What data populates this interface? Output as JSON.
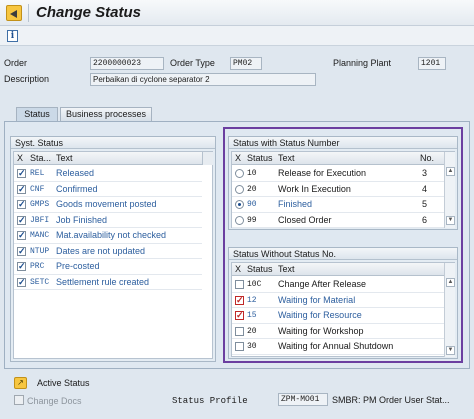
{
  "title": "Change Status",
  "header": {
    "order_label": "Order",
    "order_value": "2200000023",
    "order_type_label": "Order Type",
    "order_type_value": "PM02",
    "planning_plant_label": "Planning Plant",
    "planning_plant_value": "1201",
    "description_label": "Description",
    "description_value": "Perbaikan di cyclone separator 2"
  },
  "tabs": [
    {
      "label": "Status",
      "active": true
    },
    {
      "label": "Business processes",
      "active": false
    }
  ],
  "syst_status": {
    "title": "Syst. Status",
    "columns": [
      "X",
      "Sta...",
      "Text"
    ],
    "rows": [
      {
        "checked": true,
        "code": "REL",
        "text": "Released"
      },
      {
        "checked": true,
        "code": "CNF",
        "text": "Confirmed"
      },
      {
        "checked": true,
        "code": "GMPS",
        "text": "Goods movement posted"
      },
      {
        "checked": true,
        "code": "JBFI",
        "text": "Job Finished"
      },
      {
        "checked": true,
        "code": "MANC",
        "text": "Mat.availability not checked"
      },
      {
        "checked": true,
        "code": "NTUP",
        "text": "Dates are not updated"
      },
      {
        "checked": true,
        "code": "PRC",
        "text": "Pre-costed"
      },
      {
        "checked": true,
        "code": "SETC",
        "text": "Settlement rule created"
      }
    ]
  },
  "status_with_number": {
    "title": "Status with Status Number",
    "columns": [
      "X",
      "Status",
      "Text",
      "No."
    ],
    "rows": [
      {
        "selected": false,
        "code": "10",
        "text": "Release for Execution",
        "no": "3"
      },
      {
        "selected": false,
        "code": "20",
        "text": "Work In Execution",
        "no": "4"
      },
      {
        "selected": true,
        "code": "90",
        "text": "Finished",
        "no": "5"
      },
      {
        "selected": false,
        "code": "99",
        "text": "Closed Order",
        "no": "6"
      }
    ]
  },
  "status_without_number": {
    "title": "Status Without Status No.",
    "columns": [
      "X",
      "Status",
      "Text"
    ],
    "rows": [
      {
        "checked": false,
        "code": "10C",
        "text": "Change After Release"
      },
      {
        "checked": true,
        "code": "12",
        "text": "Waiting for Material"
      },
      {
        "checked": true,
        "code": "15",
        "text": "Waiting for Resource"
      },
      {
        "checked": false,
        "code": "20",
        "text": "Waiting for Workshop"
      },
      {
        "checked": false,
        "code": "30",
        "text": "Waiting for Annual Shutdown"
      }
    ]
  },
  "footer": {
    "active_status_label": "Active Status",
    "change_docs_label": "Change Docs",
    "status_profile_label": "Status Profile",
    "status_profile_value": "ZPM-MO01",
    "status_profile_desc": "SMBR: PM Order User Stat..."
  },
  "colors": {
    "highlight_border": "#6b3fa0",
    "link_blue": "#2c5e9e",
    "background": "#dfe7ef"
  }
}
